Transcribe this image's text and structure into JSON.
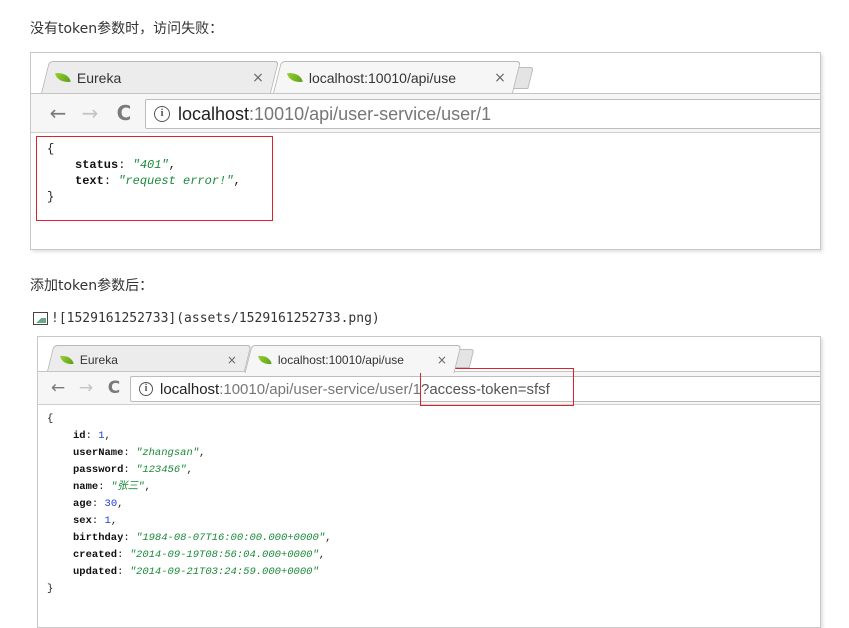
{
  "text1": "没有token参数时，访问失败：",
  "text2": "添加token参数后：",
  "image_markdown": "![1529161252733](assets/1529161252733.png)",
  "browser1": {
    "tabs": [
      {
        "label": "Eureka",
        "close": "×"
      },
      {
        "label": "localhost:10010/api/use",
        "close": "×"
      }
    ],
    "nav": {
      "back": "←",
      "forward": "→",
      "reload": "C"
    },
    "info": "i",
    "url_host": "localhost",
    "url_path": ":10010/api/user-service/user/1",
    "json": {
      "open": "{",
      "close": "}",
      "fields": [
        {
          "key": "status",
          "value": "\"401\"",
          "type": "string"
        },
        {
          "key": "text",
          "value": "\"request error!\"",
          "type": "string"
        }
      ]
    }
  },
  "browser2": {
    "tabs": [
      {
        "label": "Eureka",
        "close": "×"
      },
      {
        "label": "localhost:10010/api/use",
        "close": "×"
      }
    ],
    "nav": {
      "back": "←",
      "forward": "→",
      "reload": "C"
    },
    "info": "i",
    "url_host": "localhost",
    "url_path": ":10010/api/user-service/user/1",
    "url_query": "?access-token=sfsf",
    "json": {
      "open": "{",
      "close": "}",
      "fields": [
        {
          "key": "id",
          "value": "1",
          "type": "number"
        },
        {
          "key": "userName",
          "value": "\"zhangsan\"",
          "type": "string"
        },
        {
          "key": "password",
          "value": "\"123456\"",
          "type": "string"
        },
        {
          "key": "name",
          "value": "\"张三\"",
          "type": "string"
        },
        {
          "key": "age",
          "value": "30",
          "type": "number"
        },
        {
          "key": "sex",
          "value": "1",
          "type": "number"
        },
        {
          "key": "birthday",
          "value": "\"1984-08-07T16:00:00.000+0000\"",
          "type": "string"
        },
        {
          "key": "created",
          "value": "\"2014-09-19T08:56:04.000+0000\"",
          "type": "string"
        },
        {
          "key": "updated",
          "value": "\"2014-09-21T03:24:59.000+0000\"",
          "type": "string"
        }
      ]
    }
  },
  "colors": {
    "highlight": "#d9232e",
    "string": "#1a8a3a",
    "number": "#1c3fd6"
  }
}
